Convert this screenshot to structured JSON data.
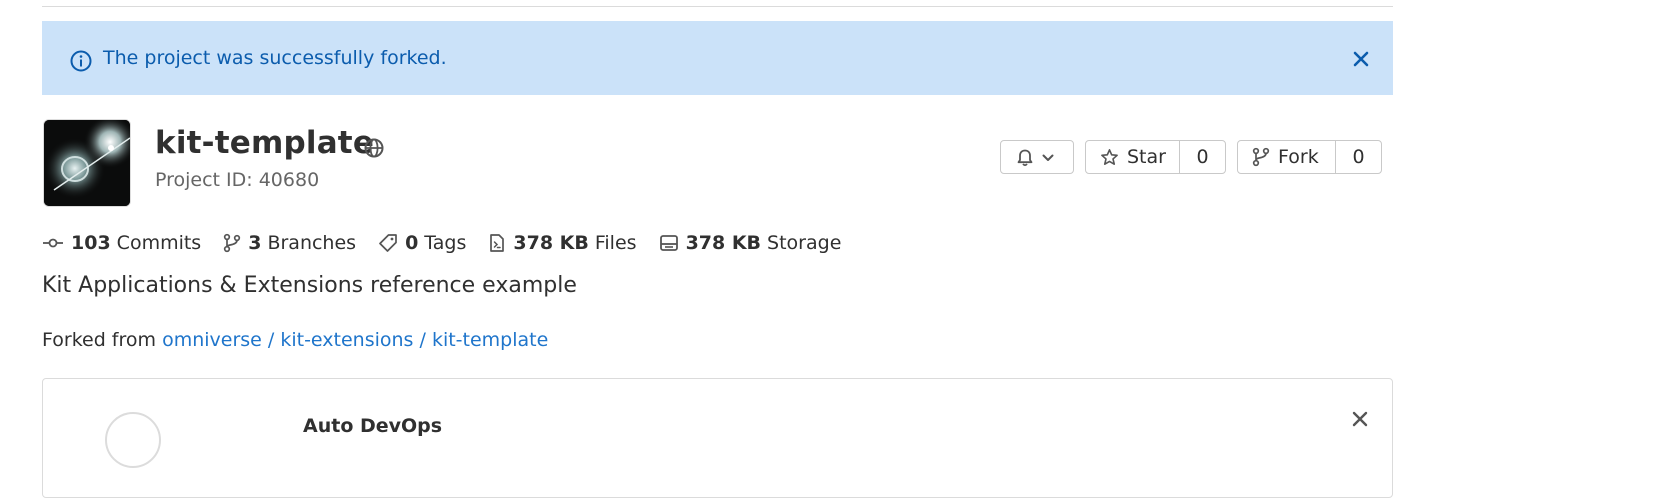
{
  "alert": {
    "message": "The project was successfully forked.",
    "icon": "info-icon",
    "close_icon": "close-icon",
    "background": "#cbe2f9",
    "text_color": "#0b5cad"
  },
  "project": {
    "name": "kit-template",
    "visibility_icon": "globe-icon",
    "id_label": "Project ID: 40680",
    "description": "Kit Applications & Extensions reference example"
  },
  "actions": {
    "notifications_icon": "bell-icon",
    "star_label": "Star",
    "star_count": "0",
    "fork_label": "Fork",
    "fork_count": "0"
  },
  "stats": [
    {
      "icon": "commit-icon",
      "value": "103",
      "label": "Commits"
    },
    {
      "icon": "branch-icon",
      "value": "3",
      "label": "Branches"
    },
    {
      "icon": "tag-icon",
      "value": "0",
      "label": "Tags"
    },
    {
      "icon": "file-icon",
      "value": "378 KB",
      "label": "Files"
    },
    {
      "icon": "storage-icon",
      "value": "378 KB",
      "label": "Storage"
    }
  ],
  "forked_from": {
    "prefix": "Forked from",
    "link_text": "omniverse / kit-extensions / kit-template"
  },
  "card": {
    "title": "Auto DevOps"
  },
  "colors": {
    "link": "#1f75cb",
    "text": "#303030",
    "muted": "#666666"
  }
}
